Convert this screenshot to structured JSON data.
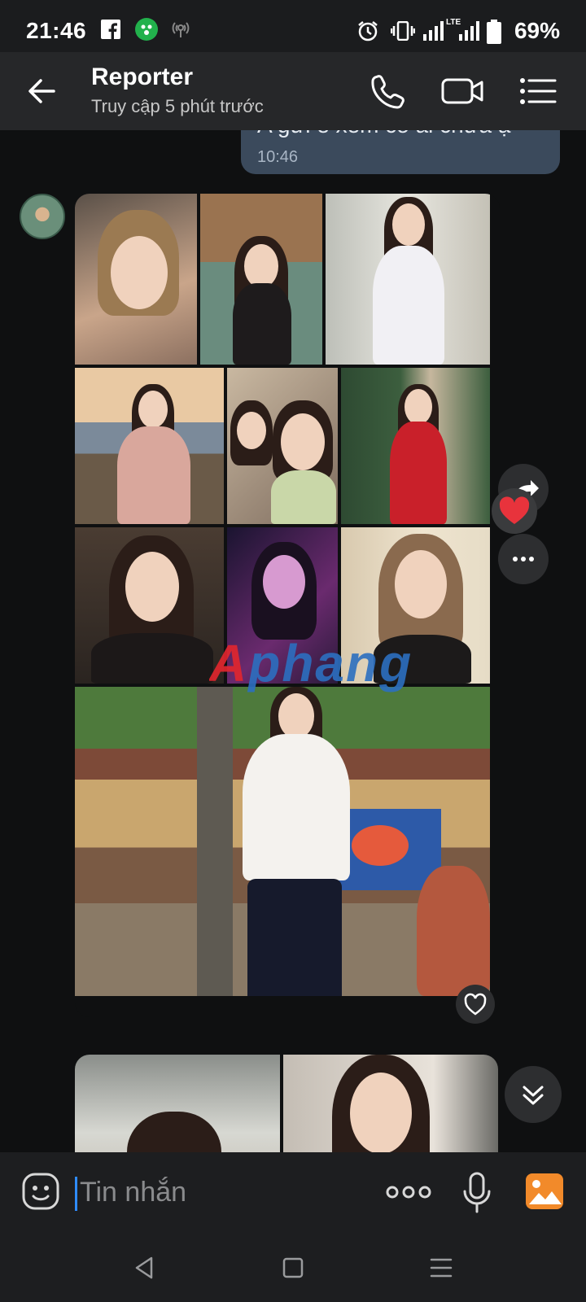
{
  "status_bar": {
    "time": "21:46",
    "battery": "69%",
    "icons": [
      "facebook-icon",
      "app-notification-icon",
      "hotspot-icon",
      "alarm-icon",
      "vibrate-icon",
      "signal-icon",
      "lte-signal-icon",
      "battery-icon"
    ],
    "network_label": "LTE"
  },
  "header": {
    "title": "Reporter",
    "subtitle": "Truy cập 5 phút trước"
  },
  "messages": {
    "sent": {
      "text": "A gửi e xem có ai chưa ạ",
      "time": "10:46"
    },
    "watermark": "Aphang"
  },
  "input": {
    "placeholder": "Tin nhắn"
  },
  "colors": {
    "accent": "#2f8cff",
    "header_bg": "#262729",
    "bubble_sent": "#3b4a5c",
    "heart": "#e8333c",
    "gallery": "#f28a2a"
  }
}
